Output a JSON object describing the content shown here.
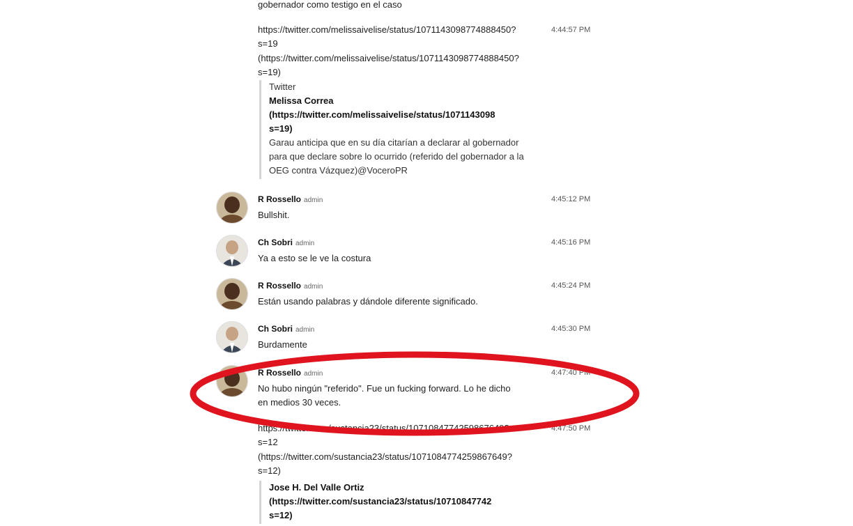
{
  "messages": {
    "top_line": "gobernador como testigo en el caso",
    "link_msg": {
      "lines": [
        "https://twitter.com/melissaivelise/status/1071143098774888450?",
        "s=19",
        "(https://twitter.com/melissaivelise/status/1071143098774888450?",
        "s=19)"
      ],
      "time": "4:44:57 PM"
    },
    "attachment1": {
      "service": "Twitter",
      "author_lines": [
        "Melissa Correa",
        "(https://twitter.com/melissaivelise/status/1071143098",
        "s=19)"
      ],
      "body_lines": [
        "Garau anticipa que en su día citarían a declarar al gobernador",
        "para que declare sobre lo ocurrido (referido del gobernador a la",
        "OEG contra Vázquez)@VoceroPR"
      ]
    },
    "m1": {
      "name": "R Rossello",
      "badge": "admin",
      "time": "4:45:12 PM",
      "text": "Bullshit."
    },
    "m2": {
      "name": "Ch Sobri",
      "badge": "admin",
      "time": "4:45:16 PM",
      "text": "Ya a esto se le ve la costura"
    },
    "m3": {
      "name": "R Rossello",
      "badge": "admin",
      "time": "4:45:24 PM",
      "text": "Están usando palabras y dándole diferente significado."
    },
    "m4": {
      "name": "Ch Sobri",
      "badge": "admin",
      "time": "4:45:30 PM",
      "text": "Burdamente"
    },
    "m5": {
      "name": "R Rossello",
      "badge": "admin",
      "time": "4:47:40 PM",
      "lines": [
        "No hubo ningún \"referido\". Fue un fucking forward.   Lo he dicho",
        "en medios 30 veces."
      ]
    },
    "link_msg2": {
      "lines": [
        "https://twitter.com/sustancia23/status/1071084774259867649?",
        "s=12",
        "(https://twitter.com/sustancia23/status/1071084774259867649?",
        "s=12)"
      ],
      "time": "4:47:50 PM"
    },
    "attachment2": {
      "author_lines": [
        "Jose H. Del Valle Ortiz",
        "(https://twitter.com/sustancia23/status/10710847742",
        "s=12)"
      ]
    }
  },
  "colors": {
    "highlight_ellipse": "#e0141e",
    "admin_badge": "#666666"
  },
  "icons": {
    "avatar_r": "avatar-photo",
    "avatar_ch": "avatar-photo"
  }
}
